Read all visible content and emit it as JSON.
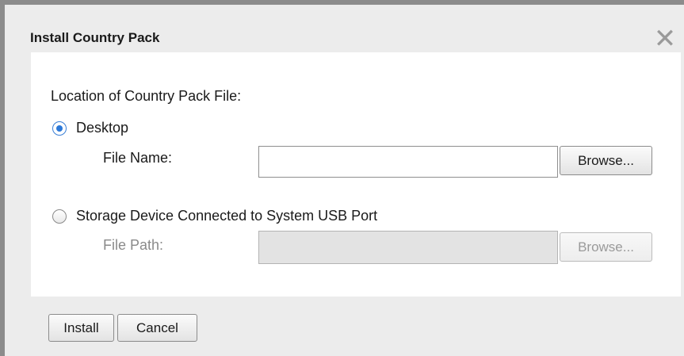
{
  "dialog": {
    "title": "Install Country Pack",
    "close_icon": "close-icon",
    "close_glyph": "✕"
  },
  "location": {
    "heading": "Location of Country Pack File:",
    "selected": "desktop",
    "desktop": {
      "label": "Desktop",
      "field_label": "File Name:",
      "value": "",
      "browse_label": "Browse..."
    },
    "usb": {
      "label": "Storage Device Connected to System USB Port",
      "field_label": "File Path:",
      "value": "",
      "browse_label": "Browse..."
    }
  },
  "footer": {
    "install_label": "Install",
    "cancel_label": "Cancel"
  },
  "colors": {
    "accent_radio": "#2b78d8",
    "dialog_background": "#ececec",
    "panel_background": "#ffffff",
    "window_border": "#8c8c8c"
  }
}
